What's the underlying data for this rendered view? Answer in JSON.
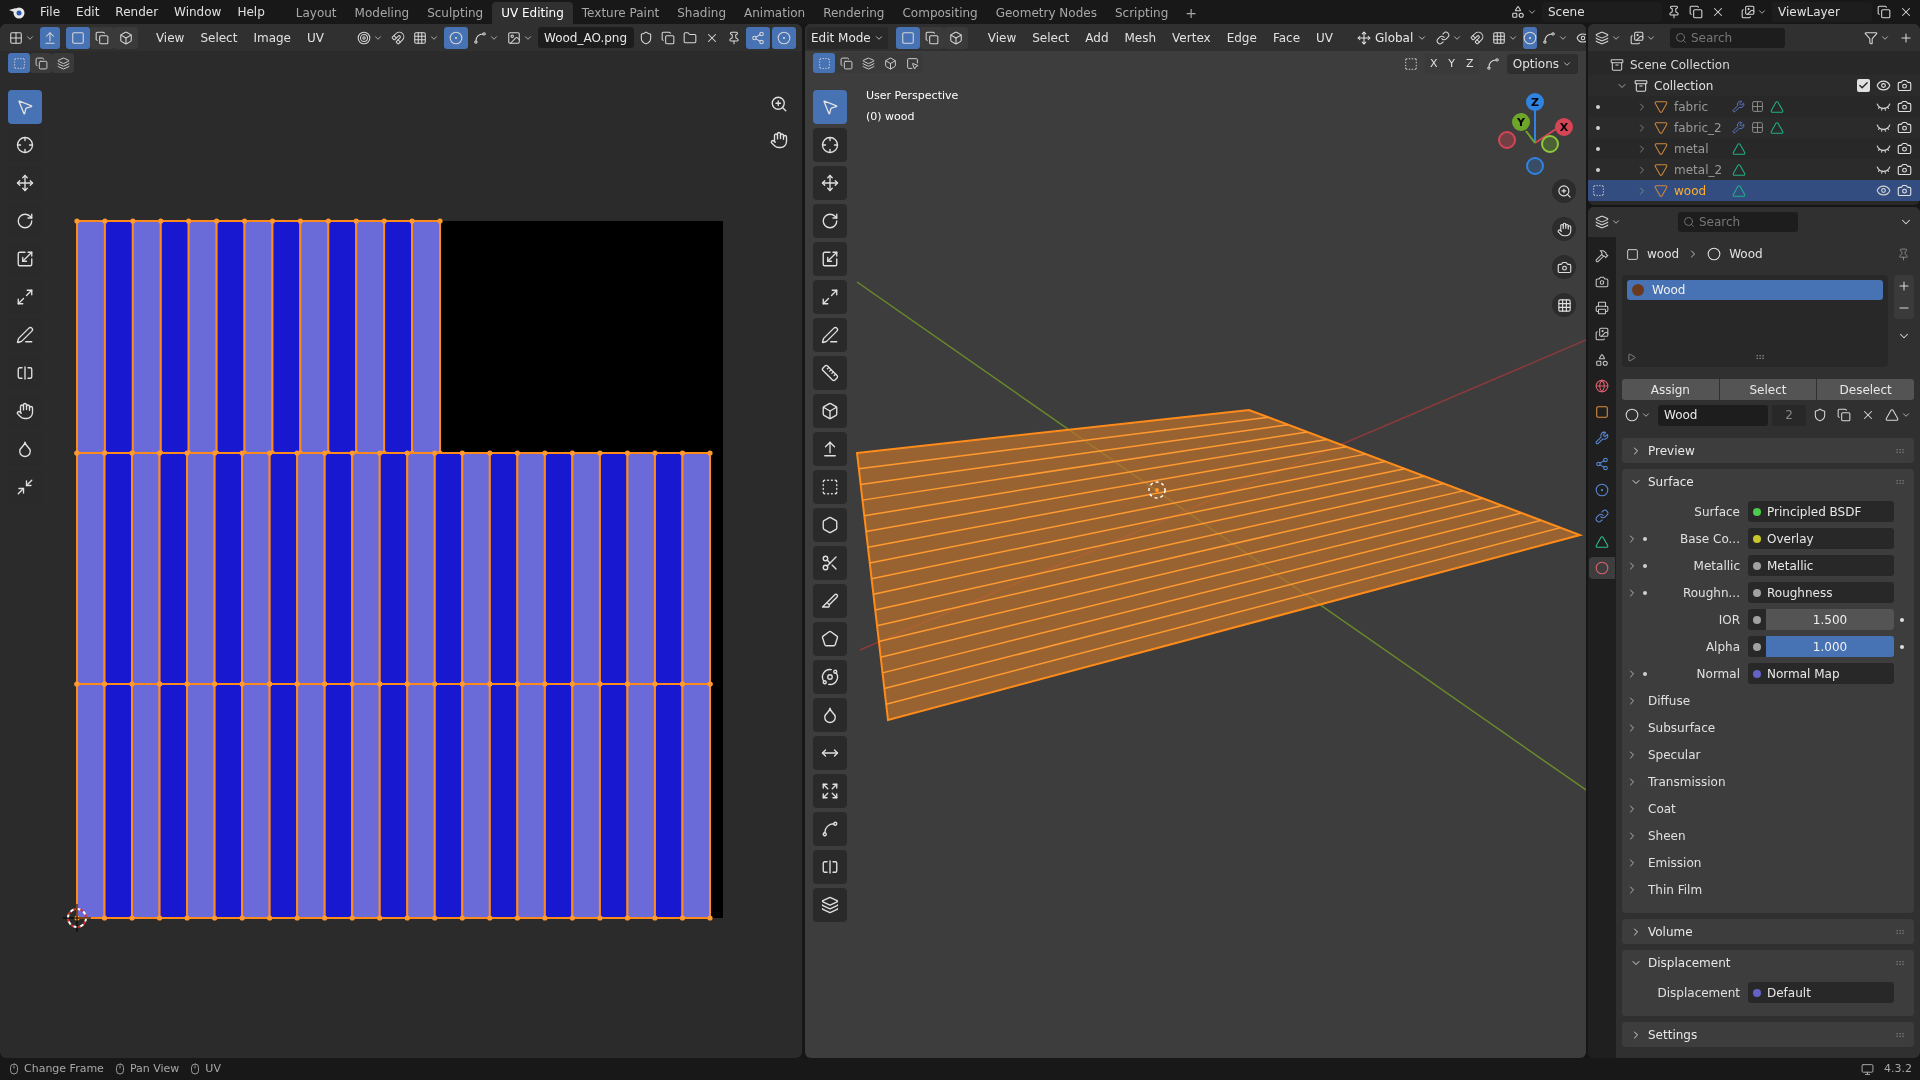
{
  "top_bar": {
    "menus": [
      "File",
      "Edit",
      "Render",
      "Window",
      "Help"
    ],
    "workspaces": [
      {
        "label": "Layout",
        "selected": false
      },
      {
        "label": "Modeling",
        "selected": false
      },
      {
        "label": "Sculpting",
        "selected": false
      },
      {
        "label": "UV Editing",
        "selected": true
      },
      {
        "label": "Texture Paint",
        "selected": false
      },
      {
        "label": "Shading",
        "selected": false
      },
      {
        "label": "Animation",
        "selected": false
      },
      {
        "label": "Rendering",
        "selected": false
      },
      {
        "label": "Compositing",
        "selected": false
      },
      {
        "label": "Geometry Nodes",
        "selected": false
      },
      {
        "label": "Scripting",
        "selected": false
      }
    ],
    "add_tab": "+",
    "scene": "Scene",
    "view_layer": "ViewLayer"
  },
  "uv_editor": {
    "select_modes": [
      {
        "selected": true
      },
      {
        "selected": false
      },
      {
        "selected": false
      }
    ],
    "menus": [
      "View",
      "Select",
      "Image",
      "UV"
    ],
    "image_name": "Wood_AO.png",
    "tools": [
      {
        "selected": true
      },
      {
        "selected": false
      },
      {
        "selected": false
      },
      {
        "selected": false
      },
      {
        "selected": false
      },
      {
        "selected": false
      },
      {
        "selected": false
      },
      {
        "selected": false
      },
      {
        "selected": false
      },
      {
        "selected": false
      },
      {
        "selected": false
      }
    ]
  },
  "viewport": {
    "mode": "Edit Mode",
    "select_modes": [
      {
        "selected": true
      },
      {
        "selected": false
      },
      {
        "selected": false
      }
    ],
    "menus": [
      "View",
      "Select",
      "Add",
      "Mesh",
      "Vertex",
      "Edge",
      "Face",
      "UV"
    ],
    "orientation": "Global",
    "mirror_axes": [
      "X",
      "Y",
      "Z"
    ],
    "options": "Options",
    "view_name": "User Perspective",
    "object_label": "(0) wood",
    "gizmo_labels": [
      "X",
      "Y",
      "Z"
    ],
    "tools": [
      {
        "selected": true
      },
      {
        "selected": false
      },
      {
        "selected": false
      },
      {
        "selected": false
      },
      {
        "selected": false
      },
      {
        "selected": false
      },
      {
        "selected": false
      },
      {
        "selected": false
      },
      {
        "selected": false
      },
      {
        "selected": false
      },
      {
        "selected": false
      },
      {
        "selected": false
      },
      {
        "selected": false
      },
      {
        "selected": false
      },
      {
        "selected": false
      },
      {
        "selected": false
      },
      {
        "selected": false
      },
      {
        "selected": false
      },
      {
        "selected": false
      },
      {
        "selected": false
      },
      {
        "selected": false
      },
      {
        "selected": false
      }
    ]
  },
  "outliner": {
    "search_placeholder": "Search",
    "root": "Scene Collection",
    "collection": {
      "name": "Collection",
      "expanded": true,
      "checked": true,
      "visible": true
    },
    "objects": [
      {
        "name": "fabric",
        "selected": false,
        "visible": false,
        "modifiers": true
      },
      {
        "name": "fabric_2",
        "selected": false,
        "visible": false,
        "modifiers": true
      },
      {
        "name": "metal",
        "selected": false,
        "visible": false,
        "modifiers": false
      },
      {
        "name": "metal_2",
        "selected": false,
        "visible": false,
        "modifiers": false
      },
      {
        "name": "wood",
        "selected": true,
        "visible": true,
        "modifiers": false
      }
    ]
  },
  "properties": {
    "search_placeholder": "Search",
    "breadcrumb": [
      "wood",
      "Wood"
    ],
    "tabs": [
      {
        "selected": false
      },
      {
        "selected": false
      },
      {
        "selected": false
      },
      {
        "selected": false
      },
      {
        "selected": false
      },
      {
        "selected": false
      },
      {
        "selected": false
      },
      {
        "selected": false
      },
      {
        "selected": false
      },
      {
        "selected": false
      },
      {
        "selected": false
      },
      {
        "selected": false
      },
      {
        "selected": true
      }
    ],
    "slots": [
      {
        "name": "Wood",
        "selected": true
      }
    ],
    "slot_actions": [
      "Assign",
      "Select",
      "Deselect"
    ],
    "material": {
      "name": "Wood",
      "users": "2"
    },
    "panels": [
      {
        "title": "Preview",
        "expanded": false
      },
      {
        "title": "Surface",
        "expanded": true,
        "rows": [
          {
            "kind": "link",
            "label": "Surface",
            "value": "Principled BSDF",
            "color": "#4ccb4c",
            "expandable": false
          },
          {
            "kind": "link",
            "label": "Base Co...",
            "value": "Overlay",
            "color": "#c7c729",
            "expandable": true
          },
          {
            "kind": "link",
            "label": "Metallic",
            "value": "Metallic",
            "color": "#a1a1a1",
            "expandable": true
          },
          {
            "kind": "link",
            "label": "Roughn...",
            "value": "Roughness",
            "color": "#a1a1a1",
            "expandable": true
          },
          {
            "kind": "slider",
            "label": "IOR",
            "value": "1.500",
            "level": 0,
            "color": "#a1a1a1"
          },
          {
            "kind": "slider",
            "label": "Alpha",
            "value": "1.000",
            "level": 1,
            "color": "#a1a1a1"
          },
          {
            "kind": "link",
            "label": "Normal",
            "value": "Normal Map",
            "color": "#6363c7",
            "expandable": true
          },
          {
            "kind": "subpanel",
            "label": "Diffuse"
          },
          {
            "kind": "subpanel",
            "label": "Subsurface"
          },
          {
            "kind": "subpanel",
            "label": "Specular"
          },
          {
            "kind": "subpanel",
            "label": "Transmission"
          },
          {
            "kind": "subpanel",
            "label": "Coat"
          },
          {
            "kind": "subpanel",
            "label": "Sheen"
          },
          {
            "kind": "subpanel",
            "label": "Emission"
          },
          {
            "kind": "subpanel",
            "label": "Thin Film"
          }
        ]
      },
      {
        "title": "Volume",
        "expanded": false
      },
      {
        "title": "Displacement",
        "expanded": true,
        "rows": [
          {
            "kind": "link",
            "label": "Displacement",
            "value": "Default",
            "color": "#6363c7",
            "expandable": false
          }
        ]
      },
      {
        "title": "Settings",
        "expanded": false
      }
    ]
  },
  "status_bar": {
    "hints": [
      "Change Frame",
      "Pan View",
      "UV"
    ],
    "version": "4.3.2"
  }
}
